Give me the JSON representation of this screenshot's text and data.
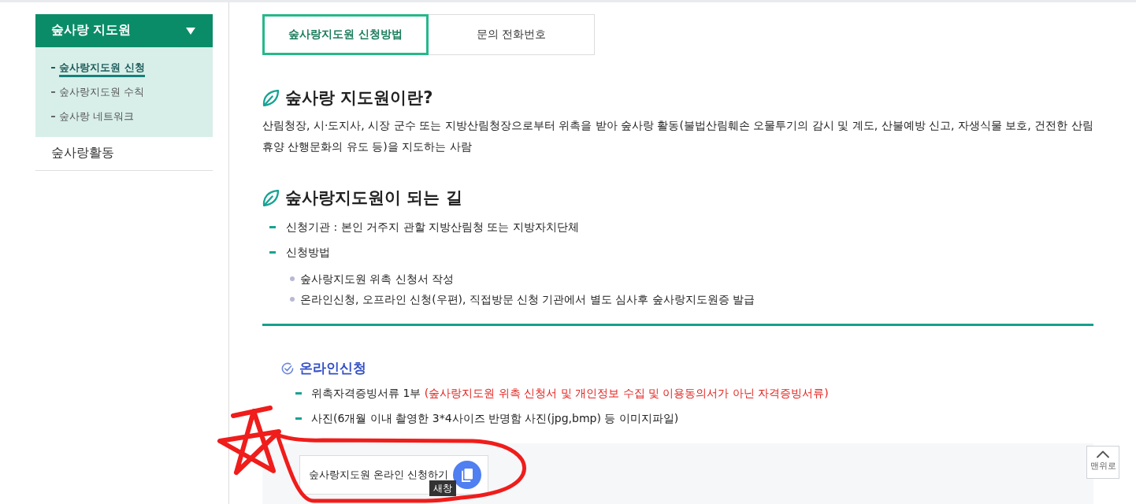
{
  "sidebar": {
    "menus": [
      {
        "label": "숲사랑 지도원",
        "expanded": true,
        "children": [
          {
            "label": "숲사랑지도원 신청",
            "selected": true
          },
          {
            "label": "숲사랑지도원 수칙",
            "selected": false
          },
          {
            "label": "숲사랑 네트워크",
            "selected": false
          }
        ]
      },
      {
        "label": "숲사랑활동",
        "expanded": false
      }
    ]
  },
  "tabs": [
    {
      "label": "숲사랑지도원 신청방법",
      "selected": true
    },
    {
      "label": "문의 전화번호",
      "selected": false
    }
  ],
  "sections": [
    {
      "kind": "paragraph",
      "title": "숲사랑 지도원이란?",
      "text": "산림청장, 시·도지사, 시장 군수 또는 지방산림청장으로부터 위촉을 받아 숲사랑 활동(불법산림훼손 오물투기의 감시 및 계도, 산불예방 신고, 자생식물 보호, 건전한 산림휴양 산행문화의 유도 등)을 지도하는 사람"
    },
    {
      "kind": "list",
      "title": "숲사랑지도원이 되는 길",
      "items": [
        {
          "text": "신청기관 : 본인 거주지 관할 지방산림청 또는 지방자치단체"
        },
        {
          "text": "신청방법",
          "children": [
            {
              "text": "숲사랑지도원 위촉 신청서 작성"
            },
            {
              "text": "온라인신청, 오프라인 신청(우편), 직접방문 신청 기관에서 별도 심사후 숲사랑지도원증 발급"
            }
          ]
        }
      ]
    }
  ],
  "online": {
    "title": "온라인신청",
    "items": [
      {
        "text": "위촉자격증빙서류 1부",
        "note": "(숲사랑지도원 위촉 신청서 및 개인정보 수집 및 이용동의서가 아닌 자격증빙서류)"
      },
      {
        "text": "사진(6개월 이내 촬영한 3*4사이즈 반명함 사진(jpg,bmp) 등 이미지파일)"
      }
    ]
  },
  "apply_button": {
    "label": "숲사랑지도원 온라인 신청하기",
    "tooltip": "새창"
  },
  "top_button": {
    "label": "맨위로"
  }
}
